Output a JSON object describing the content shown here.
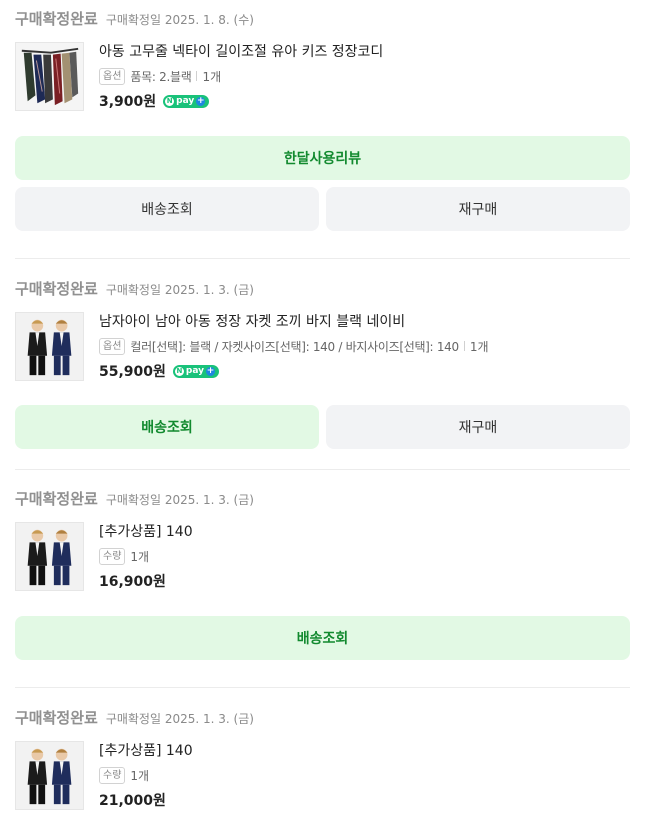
{
  "orders": [
    {
      "status": "구매확정완료",
      "date": "구매확정일 2025. 1. 8. (수)",
      "product_name": "아동 고무줄 넥타이 길이조절 유아 키즈 정장코디",
      "option_tag": "옵션",
      "option_text": "품목: 2.블랙",
      "quantity": "1개",
      "price": "3,900원",
      "npay": "pay",
      "thumb_icon": "necktie-product-image",
      "buttons": {
        "review": "한달사용리뷰",
        "delivery": "배송조회",
        "reorder": "재구매"
      }
    },
    {
      "status": "구매확정완료",
      "date": "구매확정일 2025. 1. 3. (금)",
      "product_name": "남자아이 남아 아동 정장 자켓 조끼 바지 블랙 네이비",
      "option_tag": "옵션",
      "option_text": "컬러[선택]: 블랙 / 자켓사이즈[선택]: 140 / 바지사이즈[선택]: 140",
      "quantity": "1개",
      "price": "55,900원",
      "npay": "pay",
      "thumb_icon": "kids-suit-product-image",
      "buttons": {
        "delivery": "배송조회",
        "reorder": "재구매"
      }
    },
    {
      "status": "구매확정완료",
      "date": "구매확정일 2025. 1. 3. (금)",
      "product_name": "[추가상품] 140",
      "option_tag": "수량",
      "quantity": "1개",
      "price": "16,900원",
      "thumb_icon": "kids-suit-product-image",
      "buttons": {
        "delivery": "배송조회"
      }
    },
    {
      "status": "구매확정완료",
      "date": "구매확정일 2025. 1. 3. (금)",
      "product_name": "[추가상품] 140",
      "option_tag": "수량",
      "quantity": "1개",
      "price": "21,000원",
      "thumb_icon": "kids-suit-product-image"
    }
  ],
  "colors": {
    "status_gray": "#909090",
    "green_button_bg": "#e2f9e4",
    "green_button_text": "#128a2f",
    "gray_button_bg": "#f2f3f5",
    "npay_green": "#19c27a"
  }
}
